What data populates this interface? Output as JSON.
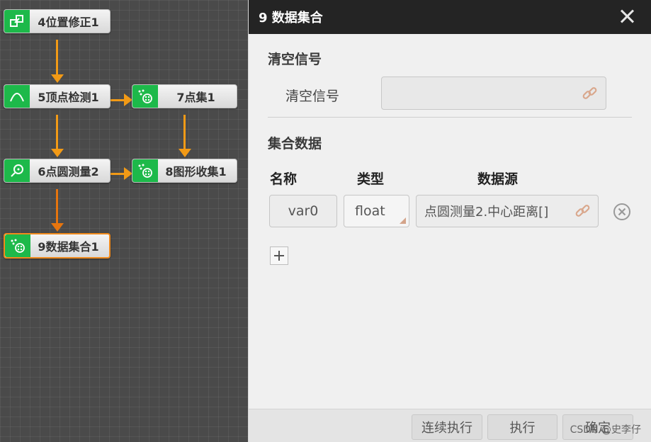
{
  "nodes": {
    "n4": "4位置修正1",
    "n5": "5顶点检测1",
    "n7": "7点集1",
    "n6": "6点圆测量2",
    "n8": "8图形收集1",
    "n9": "9数据集合1"
  },
  "panel": {
    "title": "9 数据集合",
    "clear_section": "清空信号",
    "clear_label": "清空信号",
    "collect_section": "集合数据",
    "columns": {
      "name": "名称",
      "type": "类型",
      "source": "数据源"
    },
    "row": {
      "name": "var0",
      "type": "float",
      "source": "点圆测量2.中心距离[]"
    }
  },
  "footer": {
    "continuous": "连续执行",
    "execute": "执行",
    "confirm": "确定"
  },
  "watermark": "CSDN @史李仔",
  "colors": {
    "accent": "#f29a16",
    "node_icon": "#1db94a",
    "titlebar": "#242424"
  }
}
